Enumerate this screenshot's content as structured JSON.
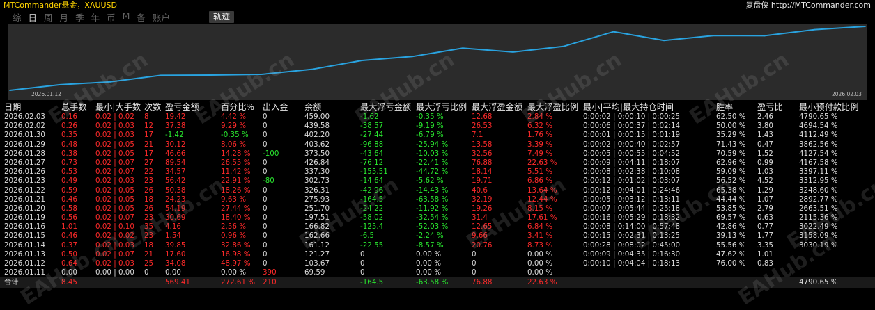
{
  "header": {
    "app_title": "MTCommander悬金，XAUUSD",
    "site": "复盘侠 http://MTCommander.com"
  },
  "periods": [
    "综",
    "日",
    "周",
    "月",
    "季",
    "年",
    "币",
    "M",
    "备",
    "账户"
  ],
  "active_period": "日",
  "track_button": "轨迹",
  "chart_data": {
    "type": "line",
    "x_start": "2026.01.12",
    "x_end": "2026.02.03",
    "series_color": "#29a3e0",
    "background": "#2b2b2b",
    "x": [
      "2026.01.11",
      "2026.01.12",
      "2026.01.13",
      "2026.01.14",
      "2026.01.15",
      "2026.01.16",
      "2026.01.19",
      "2026.01.20",
      "2026.01.21",
      "2026.01.22",
      "2026.01.23",
      "2026.01.26",
      "2026.01.27",
      "2026.01.28",
      "2026.01.29",
      "2026.01.30",
      "2026.02.02",
      "2026.02.03"
    ],
    "values": [
      69.59,
      103.67,
      121.27,
      161.12,
      162.66,
      166.82,
      197.51,
      251.7,
      275.93,
      326.31,
      302.73,
      337.3,
      426.84,
      373.5,
      403.62,
      402.2,
      439.58,
      459.0
    ]
  },
  "table": {
    "headers": [
      "日期",
      "总手数",
      "最小|大手数",
      "次数",
      "盈亏金额",
      "百分比%",
      "出入金",
      "余额",
      "最大浮亏金额",
      "最大浮亏比例",
      "最大浮盈金额",
      "最大浮盈比例",
      "最小|平均|最大持仓时间",
      "胜率",
      "盈亏比",
      "最小预付款比例"
    ],
    "rows": [
      {
        "date": "2026.02.03",
        "lots": "0.16",
        "minmax": "0.02 | 0.02",
        "count": "8",
        "pl": "19.42",
        "pct": "4.42 %",
        "io": "0",
        "bal": "459.00",
        "mfl": "-1.62",
        "mflp": "-0.35 %",
        "mfp": "12.68",
        "mfpp": "2.84 %",
        "time": "0:00:02 | 0:00:10 | 0:00:25",
        "win": "62.50 %",
        "plr": "2.46",
        "adv": "4790.65 %"
      },
      {
        "date": "2026.02.02",
        "lots": "0.26",
        "minmax": "0.02 | 0.03",
        "count": "12",
        "pl": "37.38",
        "pct": "9.29 %",
        "io": "0",
        "bal": "439.58",
        "mfl": "-38.57",
        "mflp": "-9.19 %",
        "mfp": "26.53",
        "mfpp": "6.32 %",
        "time": "0:00:06 | 0:00:37 | 0:02:14",
        "win": "50.00 %",
        "plr": "3.80",
        "adv": "4694.54 %"
      },
      {
        "date": "2026.01.30",
        "lots": "0.35",
        "minmax": "0.02 | 0.03",
        "count": "17",
        "pl": "-1.42",
        "pct": "-0.35 %",
        "io": "0",
        "bal": "402.20",
        "mfl": "-27.44",
        "mflp": "-6.79 %",
        "mfp": "7.1",
        "mfpp": "1.76 %",
        "time": "0:00:01 | 0:00:15 | 0:01:19",
        "win": "35.29 %",
        "plr": "1.43",
        "adv": "4112.49 %"
      },
      {
        "date": "2026.01.29",
        "lots": "0.48",
        "minmax": "0.02 | 0.05",
        "count": "21",
        "pl": "30.12",
        "pct": "8.06 %",
        "io": "0",
        "bal": "403.62",
        "mfl": "-96.88",
        "mflp": "-25.94 %",
        "mfp": "13.58",
        "mfpp": "3.39 %",
        "time": "0:00:02 | 0:00:40 | 0:02:57",
        "win": "71.43 %",
        "plr": "0.47",
        "adv": "3862.56 %"
      },
      {
        "date": "2026.01.28",
        "lots": "0.38",
        "minmax": "0.02 | 0.05",
        "count": "17",
        "pl": "46.66",
        "pct": "14.28 %",
        "io": "-100",
        "bal": "373.50",
        "mfl": "-43.64",
        "mflp": "-10.03 %",
        "mfp": "32.56",
        "mfpp": "7.49 %",
        "time": "0:00:05 | 0:00:55 | 0:04:52",
        "win": "70.59 %",
        "plr": "1.52",
        "adv": "4127.54 %"
      },
      {
        "date": "2026.01.27",
        "lots": "0.73",
        "minmax": "0.02 | 0.07",
        "count": "27",
        "pl": "89.54",
        "pct": "26.55 %",
        "io": "0",
        "bal": "426.84",
        "mfl": "-76.12",
        "mflp": "-22.41 %",
        "mfp": "76.88",
        "mfpp": "22.63 %",
        "time": "0:00:09 | 0:04:11 | 0:18:07",
        "win": "62.96 %",
        "plr": "0.99",
        "adv": "4167.58 %"
      },
      {
        "date": "2026.01.26",
        "lots": "0.53",
        "minmax": "0.02 | 0.07",
        "count": "22",
        "pl": "34.57",
        "pct": "11.42 %",
        "io": "0",
        "bal": "337.30",
        "mfl": "-155.51",
        "mflp": "-44.72 %",
        "mfp": "18.14",
        "mfpp": "5.51 %",
        "time": "0:00:08 | 0:02:38 | 0:10:08",
        "win": "59.09 %",
        "plr": "1.03",
        "adv": "3397.11 %"
      },
      {
        "date": "2026.01.23",
        "lots": "0.49",
        "minmax": "0.02 | 0.03",
        "count": "23",
        "pl": "56.42",
        "pct": "22.91 %",
        "io": "-80",
        "bal": "302.73",
        "mfl": "-14.64",
        "mflp": "-5.62 %",
        "mfp": "19.71",
        "mfpp": "6.86 %",
        "time": "0:00:12 | 0:01:02 | 0:03:07",
        "win": "56.52 %",
        "plr": "4.52",
        "adv": "3312.95 %"
      },
      {
        "date": "2026.01.22",
        "lots": "0.59",
        "minmax": "0.02 | 0.05",
        "count": "26",
        "pl": "50.38",
        "pct": "18.26 %",
        "io": "0",
        "bal": "326.31",
        "mfl": "-42.96",
        "mflp": "-14.43 %",
        "mfp": "40.6",
        "mfpp": "13.64 %",
        "time": "0:00:12 | 0:04:01 | 0:24:46",
        "win": "65.38 %",
        "plr": "1.29",
        "adv": "3248.60 %"
      },
      {
        "date": "2026.01.21",
        "lots": "0.46",
        "minmax": "0.02 | 0.05",
        "count": "18",
        "pl": "24.23",
        "pct": "9.63 %",
        "io": "0",
        "bal": "275.93",
        "mfl": "-164.5",
        "mflp": "-63.58 %",
        "mfp": "32.19",
        "mfpp": "12.44 %",
        "time": "0:00:05 | 0:03:12 | 0:13:11",
        "win": "44.44 %",
        "plr": "1.07",
        "adv": "2892.77 %"
      },
      {
        "date": "2026.01.20",
        "lots": "0.58",
        "minmax": "0.02 | 0.05",
        "count": "26",
        "pl": "54.19",
        "pct": "27.44 %",
        "io": "0",
        "bal": "251.70",
        "mfl": "-24.22",
        "mflp": "-11.92 %",
        "mfp": "19.26",
        "mfpp": "8.15 %",
        "time": "0:00:07 | 0:05:44 | 0:25:18",
        "win": "53.85 %",
        "plr": "2.79",
        "adv": "2663.51 %"
      },
      {
        "date": "2026.01.19",
        "lots": "0.56",
        "minmax": "0.02 | 0.07",
        "count": "23",
        "pl": "30.69",
        "pct": "18.40 %",
        "io": "0",
        "bal": "197.51",
        "mfl": "-58.02",
        "mflp": "-32.54 %",
        "mfp": "31.4",
        "mfpp": "17.61 %",
        "time": "0:00:16 | 0:05:29 | 0:18:32",
        "win": "69.57 %",
        "plr": "0.63",
        "adv": "2115.36 %"
      },
      {
        "date": "2026.01.16",
        "lots": "1.01",
        "minmax": "0.02 | 0.10",
        "count": "35",
        "pl": "4.16",
        "pct": "2.56 %",
        "io": "0",
        "bal": "166.82",
        "mfl": "-125.4",
        "mflp": "-52.03 %",
        "mfp": "12.65",
        "mfpp": "6.84 %",
        "time": "0:00:08 | 0:14:00 | 0:57:48",
        "win": "42.86 %",
        "plr": "0.77",
        "adv": "3022.49 %"
      },
      {
        "date": "2026.01.15",
        "lots": "0.46",
        "minmax": "0.02 | 0.02",
        "count": "23",
        "pl": "1.54",
        "pct": "0.96 %",
        "io": "0",
        "bal": "162.66",
        "mfl": "-6.5",
        "mflp": "-2.24 %",
        "mfp": "9.66",
        "mfpp": "3.41 %",
        "time": "0:00:15 | 0:02:31 | 0:13:25",
        "win": "39.13 %",
        "plr": "1.77",
        "adv": "3158.09 %"
      },
      {
        "date": "2026.01.14",
        "lots": "0.37",
        "minmax": "0.02 | 0.03",
        "count": "18",
        "pl": "39.85",
        "pct": "32.86 %",
        "io": "0",
        "bal": "161.12",
        "mfl": "-22.55",
        "mflp": "-8.57 %",
        "mfp": "20.76",
        "mfpp": "8.73 %",
        "time": "0:00:28 | 0:08:02 | 0:45:00",
        "win": "55.56 %",
        "plr": "3.35",
        "adv": "3030.19 %"
      },
      {
        "date": "2026.01.13",
        "lots": "0.50",
        "minmax": "0.02 | 0.07",
        "count": "21",
        "pl": "17.60",
        "pct": "16.98 %",
        "io": "0",
        "bal": "121.27",
        "mfl": "0",
        "mflp": "0.00 %",
        "mfp": "0",
        "mfpp": "0.00 %",
        "time": "0:00:09 | 0:04:35 | 0:16:30",
        "win": "47.62 %",
        "plr": "1.01",
        "adv": ""
      },
      {
        "date": "2026.01.12",
        "lots": "0.64",
        "minmax": "0.02 | 0.03",
        "count": "25",
        "pl": "34.08",
        "pct": "48.97 %",
        "io": "0",
        "bal": "103.67",
        "mfl": "0",
        "mflp": "0.00 %",
        "mfp": "0",
        "mfpp": "0.00 %",
        "time": "0:00:10 | 0:04:04 | 0:18:13",
        "win": "76.00 %",
        "plr": "0.83",
        "adv": ""
      },
      {
        "date": "2026.01.11",
        "lots": "0.00",
        "minmax": "0.00 | 0.00",
        "count": "0",
        "pl": "0.00",
        "pct": "0.00 %",
        "io": "390",
        "bal": "69.59",
        "mfl": "0",
        "mflp": "0.00 %",
        "mfp": "0",
        "mfpp": "0.00 %",
        "time": "",
        "win": "",
        "plr": "",
        "adv": ""
      }
    ],
    "total": {
      "date": "合计",
      "lots": "8.45",
      "pl": "569.41",
      "pct": "272.61 %",
      "io": "210",
      "mfl": "-164.5",
      "mflp": "-63.58 %",
      "mfp": "76.88",
      "mfpp": "22.63 %",
      "adv": "4790.65 %"
    }
  },
  "watermark": "EAHub.cn"
}
